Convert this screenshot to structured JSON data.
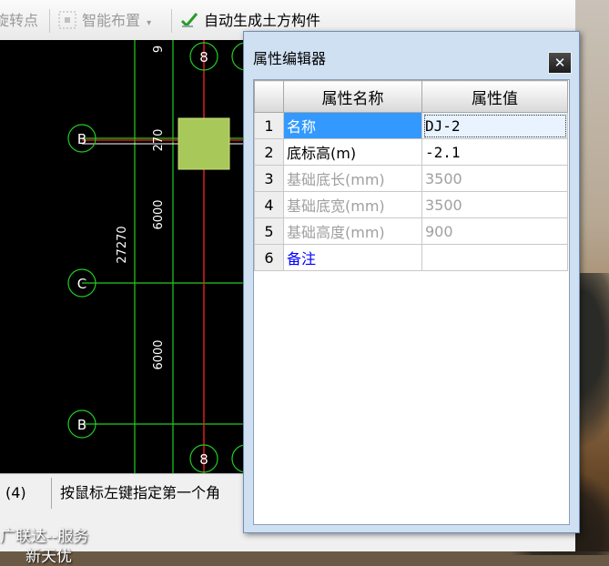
{
  "toolbar": {
    "items": [
      {
        "label": "旋转点",
        "icon": "rotate-point-icon"
      },
      {
        "label": "智能布置",
        "icon": "smart-layout-icon",
        "dropdown": true
      },
      {
        "label": "自动生成土方构件",
        "icon": "auto-generate-check-icon"
      }
    ]
  },
  "canvas": {
    "axis_labels": [
      "8",
      "8",
      "B",
      "B",
      "C",
      "B"
    ],
    "dimensions": [
      "9",
      "270",
      "6000",
      "27270",
      "6000"
    ]
  },
  "statusbar": {
    "cell1": "(4)",
    "cell2": "按鼠标左键指定第一个角"
  },
  "dialog": {
    "title": "属性编辑器",
    "close": "✕",
    "columns": [
      "属性名称",
      "属性值"
    ],
    "rows": [
      {
        "n": "1",
        "name": "名称",
        "value": "DJ-2",
        "style": "selected"
      },
      {
        "n": "2",
        "name": "底标高(m)",
        "value": "-2.1",
        "style": "normal"
      },
      {
        "n": "3",
        "name": "基础底长(mm)",
        "value": "3500",
        "style": "grey"
      },
      {
        "n": "4",
        "name": "基础底宽(mm)",
        "value": "3500",
        "style": "grey"
      },
      {
        "n": "5",
        "name": "基础高度(mm)",
        "value": "900",
        "style": "grey"
      },
      {
        "n": "6",
        "name": "备注",
        "value": "",
        "style": "blue"
      }
    ]
  },
  "desktop": {
    "line1": "广联达--服务",
    "line2": "新天优"
  }
}
